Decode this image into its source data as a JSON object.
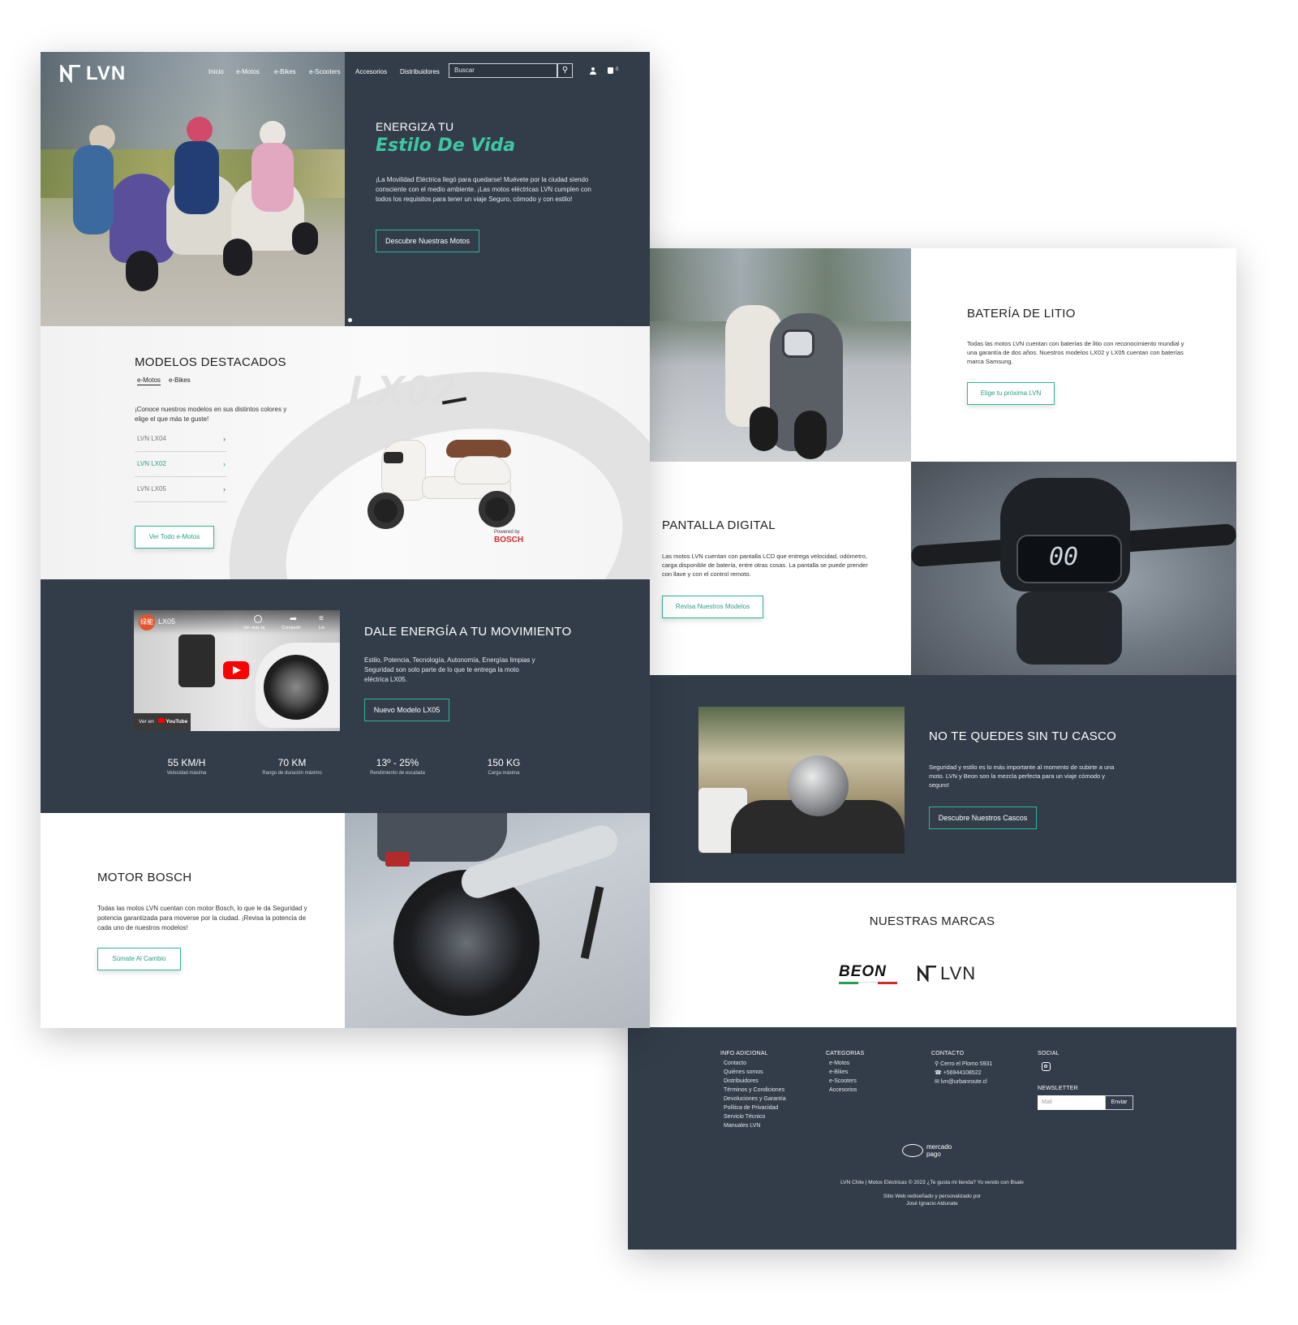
{
  "colors": {
    "dark_bg": "#333d4a",
    "accent": "#2fb398",
    "accent_text": "#2a9e86",
    "script_heading": "#3ec7a3",
    "bosch_red": "#d42e2e"
  },
  "header": {
    "logo": "LVN",
    "nav": [
      "Inicio",
      "e-Motos",
      "e-Bikes",
      "e-Scooters",
      "Accesorios",
      "Distribuidores"
    ],
    "search_placeholder": "Buscar",
    "cart_count": "0",
    "icons": [
      "search-icon",
      "user-icon",
      "cart-icon"
    ]
  },
  "hero": {
    "title_line1": "ENERGIZA TU",
    "title_line2": "Estilo De Vida",
    "text": "¡La Movilidad Eléctrica llegó para quedarse! Muévete por la ciudad siendo consciente con el medio ambiente. ¡Las motos eléctricas LVN cumplen con todos los requisitos para tener un viaje Seguro, cómodo y con estilo!",
    "button": "Descubre Nuestras Motos"
  },
  "featured": {
    "title": "MODELOS DESTACADOS",
    "tabs": [
      "e-Motos",
      "e-Bikes"
    ],
    "text": "¡Conoce nuestros modelos en sus distintos colores y elige el que más te guste!",
    "models": [
      "LVN LX04",
      "LVN LX02",
      "LVN LX05"
    ],
    "active_model_index": 1,
    "watermark": "LX02",
    "button": "Ver Todo e-Motos",
    "powered_by": "Powered by",
    "bosch": "BOSCH"
  },
  "video_section": {
    "video_badge": "绿能",
    "video_title": "LX05",
    "video_actions": [
      "Ver más ta",
      "Compartir",
      "Lis"
    ],
    "watch_on": "Ver en",
    "youtube": "YouTube",
    "title": "DALE ENERGÍA A TU MOVIMIENTO",
    "text": "Estilo, Potencia, Tecnología, Autonomía, Energías limpias y Seguridad son solo parte de lo que te entrega la moto eléctrica LX05.",
    "button": "Nuevo Modelo LX05",
    "stats": [
      {
        "value": "55 KM/H",
        "label": "Velocidad máxima"
      },
      {
        "value": "70 KM",
        "label": "Rango de duración máximo"
      },
      {
        "value": "13º - 25%",
        "label": "Rendimiento de escalada"
      },
      {
        "value": "150 KG",
        "label": "Carga máxima"
      }
    ]
  },
  "motor": {
    "title": "MOTOR BOSCH",
    "text": "Todas las motos LVN cuentan con motor Bosch, lo que le da Seguridad y potencia garantizada para moverse por la ciudad. ¡Revisa la potencia de cada uno de nuestros modelos!",
    "button": "Súmate Al Cambio"
  },
  "battery": {
    "title": "BATERÍA DE LITIO",
    "text": "Todas las motos LVN cuentan con baterías de litio con reconocimiento mundial y una garantía de dos años. Nuestros modelos LX02 y LX05 cuentan con baterías marca Samsung.",
    "button": "Elige tu próxima LVN"
  },
  "display": {
    "title": "PANTALLA DIGITAL",
    "text": "Las motos LVN cuentan con pantalla LCD que entrega velocidad, odómetro, carga disponible de batería, entre otras cosas. La pantalla se puede prender con llave y con el control remoto.",
    "button": "Revisa Nuestros Modelos",
    "speed_readout": "00"
  },
  "helmet": {
    "title": "NO TE QUEDES SIN TU CASCO",
    "text": "Seguridad y estilo es lo más importante al momento de subirte a una moto. LVN y Beon son la mezcla perfecta para un viaje cómodo y seguro!",
    "button": "Descubre Nuestros Cascos"
  },
  "brands": {
    "title": "NUESTRAS MARCAS",
    "items": [
      "BEON",
      "LVN"
    ]
  },
  "footer": {
    "info_title": "INFO ADICIONAL",
    "info_links": [
      "Contacto",
      "Quiénes somos",
      "Distribuidores",
      "Términos y Condiciones",
      "Devoluciones y Garantía",
      "Política de Privacidad",
      "Servicio Técnico",
      "Manuales LVN"
    ],
    "cat_title": "CATEGORIAS",
    "cat_links": [
      "e-Motos",
      "e-Bikes",
      "e-Scooters",
      "Accesorios"
    ],
    "contact_title": "CONTACTO",
    "contact_lines": [
      "Cerro el Plomo 5931",
      "+56944108522",
      "lvn@urbanroute.cl"
    ],
    "social_title": "SOCIAL",
    "newsletter_title": "NEWSLETTER",
    "newsletter_placeholder": "Mail",
    "newsletter_button": "Enviar",
    "payment": "mercado pago",
    "copyright": "LVN Chile | Motos Eléctricas © 2023 ¿Te gusta mi tienda? Yo vendo con Bsale",
    "credit_line1": "Sitio Web rediseñado y personalizado por",
    "credit_line2": "José Ignacio Aldunate"
  }
}
